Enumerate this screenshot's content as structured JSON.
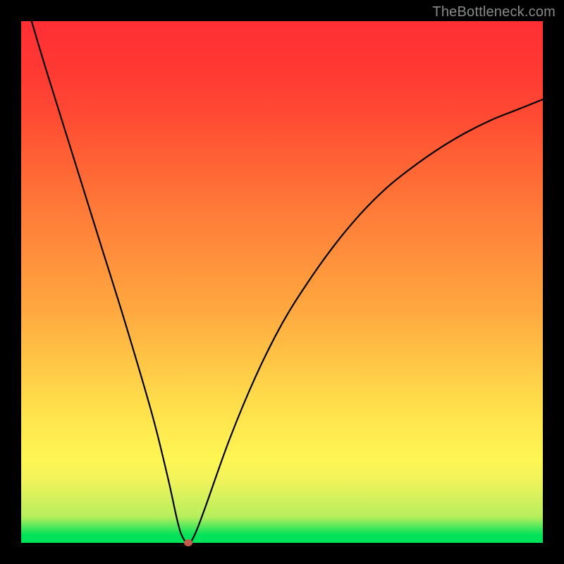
{
  "attribution": "TheBottleneck.com",
  "colors": {
    "curve": "#000000",
    "marker": "#c75a4d",
    "gradient_top": "#ff2e33",
    "gradient_bottom": "#00e25a",
    "frame": "#000000"
  },
  "chart_data": {
    "type": "line",
    "title": "",
    "xlabel": "",
    "ylabel": "",
    "xlim": [
      0,
      100
    ],
    "ylim": [
      0,
      100
    ],
    "grid": false,
    "legend": false,
    "series": [
      {
        "name": "bottleneck-curve",
        "x": [
          2,
          5,
          10,
          15,
          20,
          25,
          28,
          30,
          31,
          32,
          33,
          35,
          40,
          45,
          50,
          55,
          60,
          65,
          70,
          75,
          80,
          85,
          90,
          95,
          100
        ],
        "y": [
          100,
          90,
          74,
          58,
          42,
          25,
          13,
          4,
          1,
          0,
          1,
          6,
          20,
          32,
          42,
          50,
          57,
          63,
          68,
          72,
          75.5,
          78.5,
          81,
          83,
          85
        ]
      }
    ],
    "annotations": [
      {
        "type": "point",
        "name": "minimum-marker",
        "x": 32,
        "y": 0
      }
    ]
  }
}
